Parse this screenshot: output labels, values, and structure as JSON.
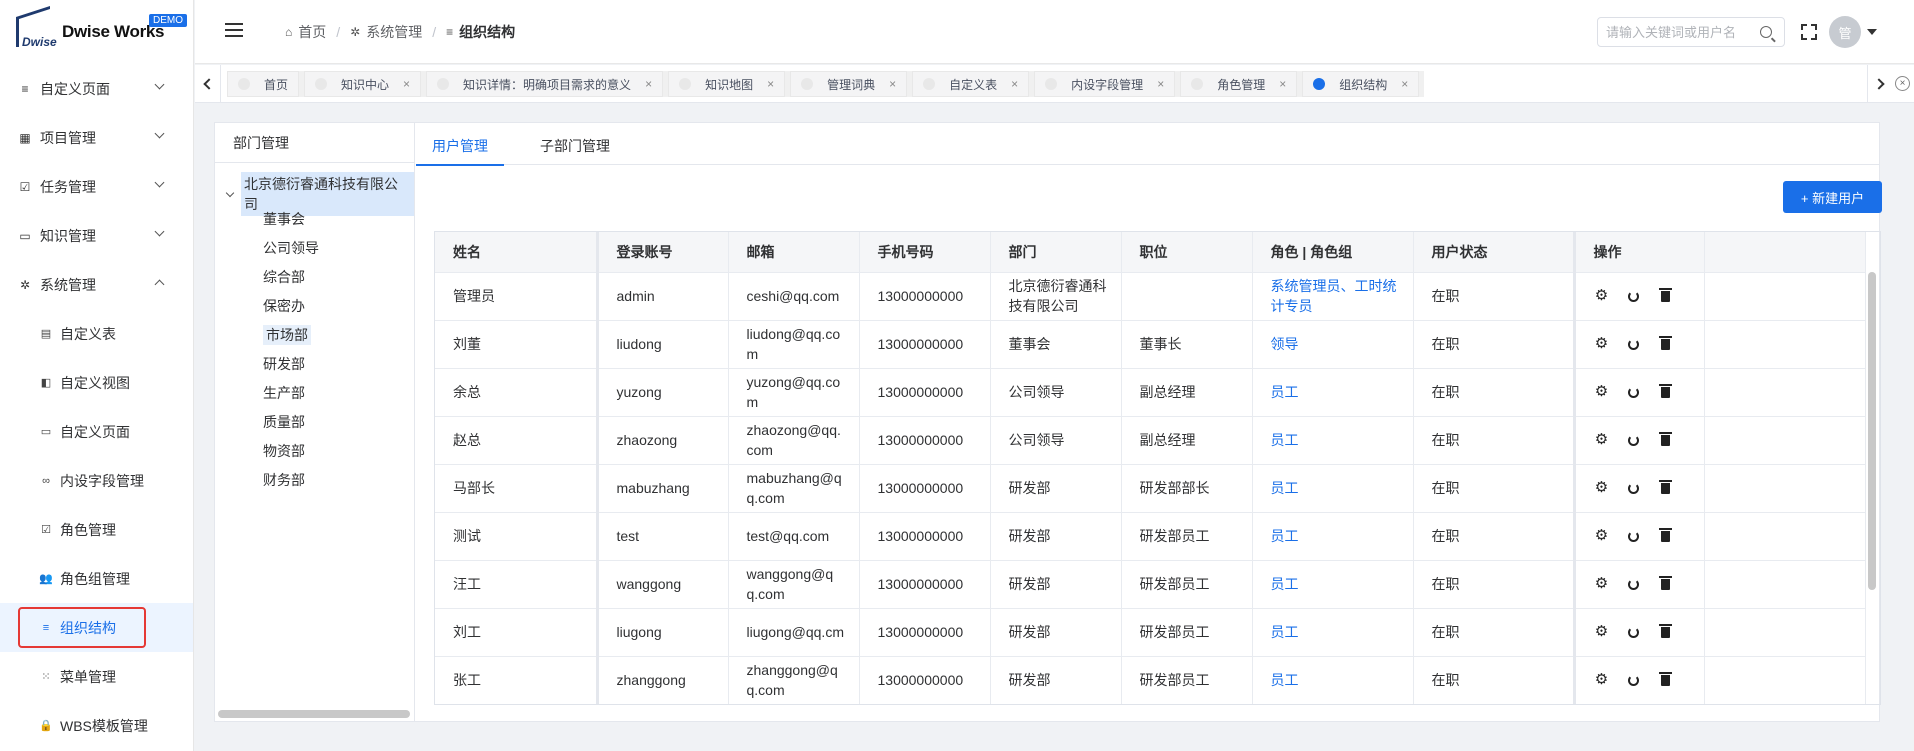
{
  "logo": {
    "mark_text": "Dwise",
    "name": "Dwise Works",
    "badge": "DEMO"
  },
  "sidebar": {
    "menu": [
      {
        "label": "自定义页面",
        "icon": "list-icon",
        "glyph": "≡",
        "expanded": false
      },
      {
        "label": "项目管理",
        "icon": "grid-icon",
        "glyph": "▦",
        "expanded": false
      },
      {
        "label": "任务管理",
        "icon": "checklist-icon",
        "glyph": "☑",
        "expanded": false
      },
      {
        "label": "知识管理",
        "icon": "book-icon",
        "glyph": "▭",
        "expanded": false
      },
      {
        "label": "系统管理",
        "icon": "gear-icon",
        "glyph": "✲",
        "expanded": true
      }
    ],
    "sub_items": [
      {
        "label": "自定义表",
        "icon": "document-icon",
        "glyph": "▤"
      },
      {
        "label": "自定义视图",
        "icon": "copy-icon",
        "glyph": "◧"
      },
      {
        "label": "自定义页面",
        "icon": "window-icon",
        "glyph": "▭"
      },
      {
        "label": "内设字段管理",
        "icon": "link-icon",
        "glyph": "∞"
      },
      {
        "label": "角色管理",
        "icon": "checkbox-icon",
        "glyph": "☑"
      },
      {
        "label": "角色组管理",
        "icon": "users-icon",
        "glyph": "👥"
      },
      {
        "label": "组织结构",
        "icon": "list-icon",
        "glyph": "≡",
        "active": true
      },
      {
        "label": "菜单管理",
        "icon": "dots-grid-icon",
        "glyph": "⁙"
      },
      {
        "label": "WBS模板管理",
        "icon": "lock-icon",
        "glyph": "🔒"
      }
    ]
  },
  "header": {
    "breadcrumb": [
      {
        "label": "首页",
        "icon": "home-icon",
        "glyph": "⌂"
      },
      {
        "label": "系统管理",
        "icon": "gear-icon",
        "glyph": "✲"
      },
      {
        "label": "组织结构",
        "icon": "list-icon",
        "glyph": "≡"
      }
    ],
    "separator": "/",
    "search_placeholder": "请输入关键词或用户名",
    "avatar_text": "管"
  },
  "tabs": [
    {
      "label": "首页",
      "closable": false
    },
    {
      "label": "知识中心",
      "closable": true
    },
    {
      "label": "知识详情：明确项目需求的意义",
      "closable": true
    },
    {
      "label": "知识地图",
      "closable": true
    },
    {
      "label": "管理词典",
      "closable": true
    },
    {
      "label": "自定义表",
      "closable": true
    },
    {
      "label": "内设字段管理",
      "closable": true
    },
    {
      "label": "角色管理",
      "closable": true
    },
    {
      "label": "组织结构",
      "closable": true,
      "active": true
    }
  ],
  "tab_close_glyph": "×",
  "dept": {
    "title": "部门管理",
    "root": "北京德衍睿通科技有限公司",
    "children": [
      "董事会",
      "公司领导",
      "综合部",
      "保密办",
      "市场部",
      "研发部",
      "生产部",
      "质量部",
      "物资部",
      "财务部"
    ],
    "selected": "市场部"
  },
  "content_tabs": [
    {
      "label": "用户管理",
      "active": true
    },
    {
      "label": "子部门管理",
      "active": false
    }
  ],
  "new_user_label": "+ 新建用户",
  "table": {
    "columns": [
      "姓名",
      "登录账号",
      "邮箱",
      "手机号码",
      "部门",
      "职位",
      "角色 | 角色组",
      "用户状态",
      "操作"
    ],
    "rows": [
      [
        "管理员",
        "admin",
        "ceshi@qq.com",
        "13000000000",
        "北京德衍睿通科技有限公司",
        "",
        "系统管理员、工时统计专员",
        "在职"
      ],
      [
        "刘董",
        "liudong",
        "liudong@qq.com",
        "13000000000",
        "董事会",
        "董事长",
        "领导",
        "在职"
      ],
      [
        "余总",
        "yuzong",
        "yuzong@qq.com",
        "13000000000",
        "公司领导",
        "副总经理",
        "员工",
        "在职"
      ],
      [
        "赵总",
        "zhaozong",
        "zhaozong@qq.com",
        "13000000000",
        "公司领导",
        "副总经理",
        "员工",
        "在职"
      ],
      [
        "马部长",
        "mabuzhang",
        "mabuzhang@qq.com",
        "13000000000",
        "研发部",
        "研发部部长",
        "员工",
        "在职"
      ],
      [
        "测试",
        "test",
        "test@qq.com",
        "13000000000",
        "研发部",
        "研发部员工",
        "员工",
        "在职"
      ],
      [
        "汪工",
        "wanggong",
        "wanggong@qq.com",
        "13000000000",
        "研发部",
        "研发部员工",
        "员工",
        "在职"
      ],
      [
        "刘工",
        "liugong",
        "liugong@qq.cm",
        "13000000000",
        "研发部",
        "研发部员工",
        "员工",
        "在职"
      ],
      [
        "张工",
        "zhanggong",
        "zhanggong@qq.com",
        "13000000000",
        "研发部",
        "研发部员工",
        "员工",
        "在职"
      ]
    ]
  },
  "colors": {
    "accent": "#1a6fe8",
    "highlight_border": "#e53935"
  }
}
